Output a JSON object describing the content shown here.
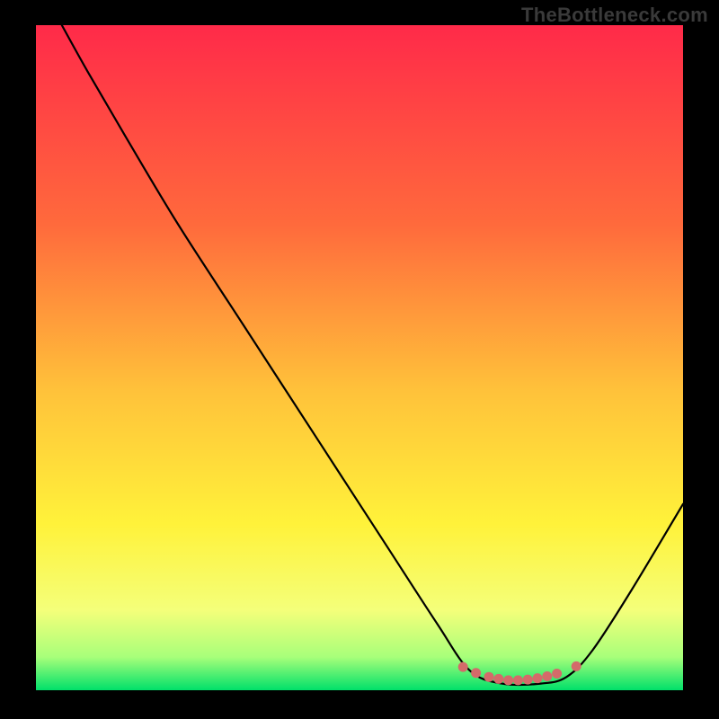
{
  "watermark": "TheBottleneck.com",
  "chart_data": {
    "type": "line",
    "title": "",
    "xlabel": "",
    "ylabel": "",
    "xlim": [
      0,
      100
    ],
    "ylim": [
      0,
      100
    ],
    "gradient_stops": [
      {
        "offset": 0,
        "color": "#ff2a49"
      },
      {
        "offset": 30,
        "color": "#ff6a3c"
      },
      {
        "offset": 55,
        "color": "#ffc23a"
      },
      {
        "offset": 75,
        "color": "#fff23a"
      },
      {
        "offset": 88,
        "color": "#f4ff7a"
      },
      {
        "offset": 95,
        "color": "#a8ff7a"
      },
      {
        "offset": 100,
        "color": "#00e06a"
      }
    ],
    "series": [
      {
        "name": "bottleneck-curve",
        "color": "#000000",
        "width": 2.2,
        "points": [
          {
            "x": 4,
            "y": 100
          },
          {
            "x": 8,
            "y": 93
          },
          {
            "x": 14,
            "y": 83
          },
          {
            "x": 22,
            "y": 70
          },
          {
            "x": 32,
            "y": 55
          },
          {
            "x": 44,
            "y": 37
          },
          {
            "x": 54,
            "y": 22
          },
          {
            "x": 62,
            "y": 10
          },
          {
            "x": 67,
            "y": 3
          },
          {
            "x": 72,
            "y": 1
          },
          {
            "x": 78,
            "y": 1
          },
          {
            "x": 82,
            "y": 2
          },
          {
            "x": 86,
            "y": 6
          },
          {
            "x": 92,
            "y": 15
          },
          {
            "x": 100,
            "y": 28
          }
        ]
      }
    ],
    "markers": {
      "name": "optimal-band",
      "color": "#d46a6a",
      "radius": 5.5,
      "points": [
        {
          "x": 66,
          "y": 3.5
        },
        {
          "x": 68,
          "y": 2.6
        },
        {
          "x": 70,
          "y": 2.0
        },
        {
          "x": 71.5,
          "y": 1.7
        },
        {
          "x": 73,
          "y": 1.5
        },
        {
          "x": 74.5,
          "y": 1.5
        },
        {
          "x": 76,
          "y": 1.6
        },
        {
          "x": 77.5,
          "y": 1.8
        },
        {
          "x": 79,
          "y": 2.1
        },
        {
          "x": 80.5,
          "y": 2.5
        },
        {
          "x": 83.5,
          "y": 3.6
        }
      ]
    }
  }
}
